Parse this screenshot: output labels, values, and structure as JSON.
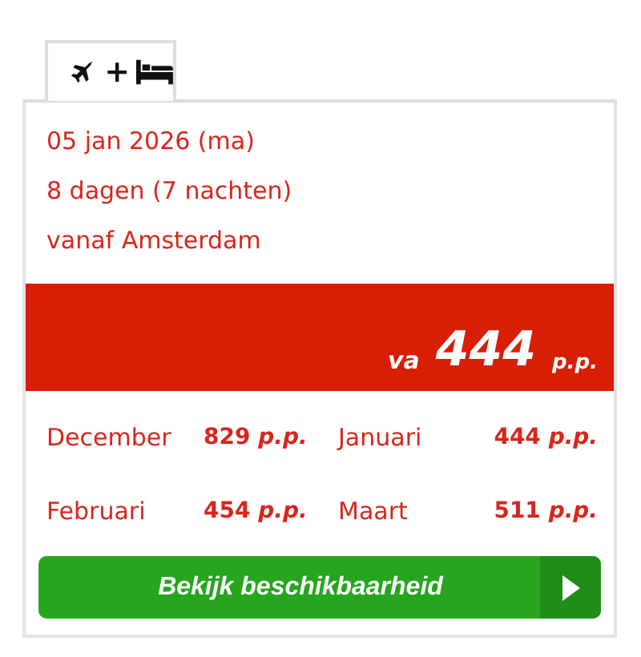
{
  "tab": {
    "separator": "+",
    "selected": true
  },
  "details": [
    "05 jan 2026 (ma)",
    "8 dagen (7 nachten)",
    "vanaf Amsterdam"
  ],
  "price_band": {
    "prefix": "va",
    "amount": "444",
    "suffix": "p.p."
  },
  "months": [
    {
      "name": "December",
      "price": "829 *p.p.*"
    },
    {
      "name": "Januari",
      "price": "444 *p.p.*"
    },
    {
      "name": "Februari",
      "price": "454 *p.p.*"
    },
    {
      "name": "Maart",
      "price": "511 *p.p.*"
    }
  ],
  "button": {
    "label": "Bekijk beschikbaarheid"
  }
}
